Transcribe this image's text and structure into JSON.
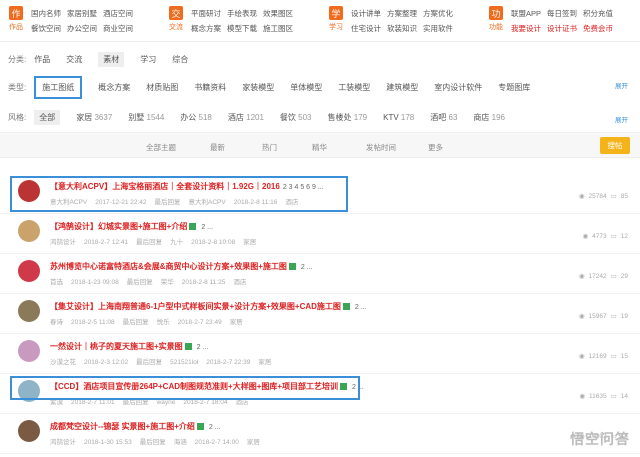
{
  "nav": [
    {
      "icon_label": "作品",
      "icon_char": "作",
      "links": [
        "国内名师",
        "家居别墅",
        "酒店空间",
        "餐饮空间",
        "办公空间",
        "商业空间"
      ]
    },
    {
      "icon_label": "交流",
      "icon_char": "交",
      "links": [
        "平面研讨",
        "手绘表现",
        "效果图区",
        "概念方案",
        "模型下载",
        "施工图区"
      ]
    },
    {
      "icon_label": "学习",
      "icon_char": "学",
      "links": [
        "设计讲单",
        "方案整理",
        "方案优化",
        "住宅设计",
        "软装知识",
        "实用软件"
      ]
    },
    {
      "icon_label": "功能",
      "icon_char": "功",
      "links": [
        "联盟APP",
        "每日签到",
        "积分充值",
        "我要设计",
        "设计证书",
        "免费会币"
      ]
    }
  ],
  "filters": {
    "category_label": "分类:",
    "category_options": [
      "作品",
      "交流",
      "素材",
      "学习",
      "综合"
    ],
    "category_selected": "素材",
    "type_label": "类型:",
    "type_options": [
      "施工图纸",
      "概念方案",
      "材质贴图",
      "书籍资料",
      "家装模型",
      "单体模型",
      "工装模型",
      "建筑模型",
      "室内设计软件",
      "专题图库"
    ],
    "type_expand": "展开",
    "style_label": "风格:",
    "style_options": [
      {
        "name": "全部",
        "count": ""
      },
      {
        "name": "家居",
        "count": "3637"
      },
      {
        "name": "别墅",
        "count": "1544"
      },
      {
        "name": "办公",
        "count": "518"
      },
      {
        "name": "酒店",
        "count": "1201"
      },
      {
        "name": "餐饮",
        "count": "503"
      },
      {
        "name": "售楼处",
        "count": "179"
      },
      {
        "name": "KTV",
        "count": "178"
      },
      {
        "name": "酒吧",
        "count": "63"
      },
      {
        "name": "商店",
        "count": "196"
      }
    ],
    "style_expand": "展开"
  },
  "sortbar": {
    "items": [
      "全部主题",
      "最新",
      "热门",
      "精华",
      "发帖时间",
      "更多"
    ],
    "search_label": "搜帖"
  },
  "threads": [
    {
      "title": "【意大利ACPV】上海宝格丽酒店｜全套设计资料｜1.92G｜2016",
      "pages": "2 3 4 5 6 9 ...",
      "author": "意大利ACPV",
      "date": "2017-12-21 22:42",
      "last_label": "最后回复",
      "last_user": "意大利ACPV",
      "last_date": "2018-2-8 11:16",
      "board": "酒店",
      "views": "25784",
      "replies": "85",
      "avatar_color": "#b33"
    },
    {
      "title": "【鸿鹄设计】幻城实景图+施工图+介绍",
      "pages": "2 ...",
      "author": "鸿鹄设计",
      "date": "2018-2-7 12:41",
      "last_label": "最后回复",
      "last_user": "九十",
      "last_date": "2018-2-8 10:08",
      "board": "家居",
      "views": "4773",
      "replies": "12",
      "avatar_color": "#c9a36b"
    },
    {
      "title": "苏州博览中心诺富特酒店&会展&商贸中心设计方案+效果图+施工图",
      "pages": "2 ...",
      "author": "首选",
      "date": "2018-1-23 09:08",
      "last_label": "最后回复",
      "last_user": "荣华",
      "last_date": "2018-2-8 11:25",
      "board": "酒店",
      "views": "17242",
      "replies": "29",
      "avatar_color": "#d0394a"
    },
    {
      "title": "【集艾设计】上海南翔普通6-1户型中式样板间实景+设计方案+效果图+CAD施工图",
      "pages": "2 ...",
      "author": "春诗",
      "date": "2018-2-5 11:08",
      "last_label": "最后回复",
      "last_user": "悦乐",
      "last_date": "2018-2-7 23:49",
      "board": "家居",
      "views": "15967",
      "replies": "19",
      "avatar_color": "#8a7a5a"
    },
    {
      "title": "一然设计｜桃子的夏天施工图+实景图",
      "pages": "2 ...",
      "author": "沙漠之花",
      "date": "2018-2-3 12:02",
      "last_label": "最后回复",
      "last_user": "521521lol",
      "last_date": "2018-2-7 22:39",
      "board": "家居",
      "views": "12169",
      "replies": "15",
      "avatar_color": "#c99ac0"
    },
    {
      "title": "【CCD】酒店项目宣传册264P+CAD制图规范准则+大样图+图库+项目部工艺培训",
      "pages": "2 ...",
      "author": "紫漠",
      "date": "2018-2-7 11:01",
      "last_label": "最后回复",
      "last_user": "wayne",
      "last_date": "2018-2-7 18:04",
      "board": "酒店",
      "views": "11635",
      "replies": "14",
      "avatar_color": "#8fb4c8"
    },
    {
      "title": "成都梵空设计--锦瑟 实景图+施工图+介绍",
      "pages": "2 ...",
      "author": "鸿鹄设计",
      "date": "2018-1-30 15:53",
      "last_label": "最后回复",
      "last_user": "海涵",
      "last_date": "2018-2-7 14:00",
      "board": "家居",
      "views": "10302",
      "replies": "14",
      "avatar_color": "#7b5a44"
    }
  ],
  "watermark": "悟空问答"
}
